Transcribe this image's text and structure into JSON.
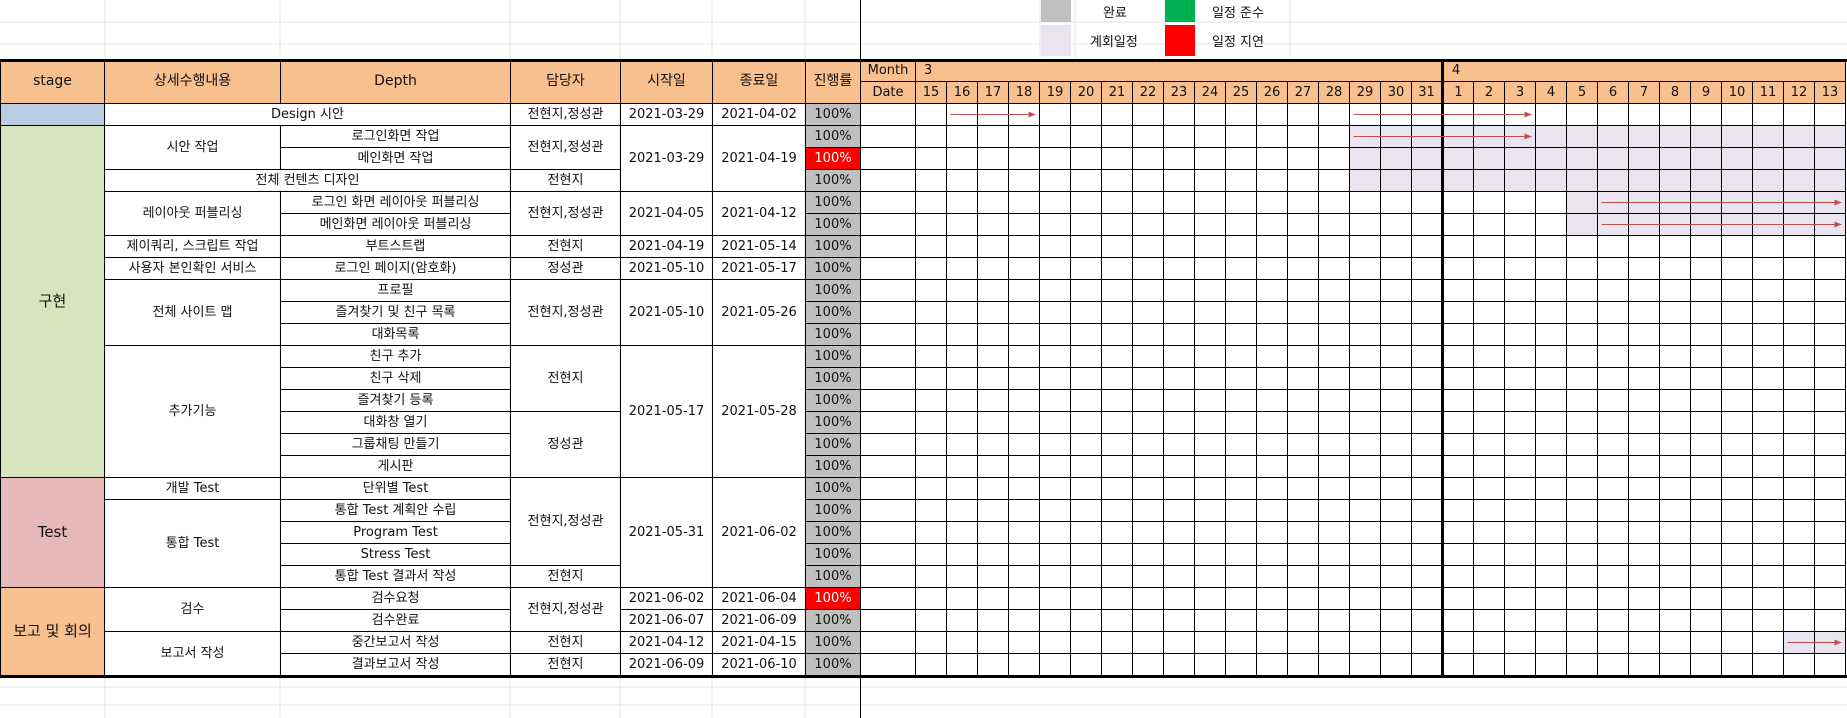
{
  "legend": [
    {
      "label": "완료",
      "color": "#bfbfbf"
    },
    {
      "label": "일정 준수",
      "color": "#00b050"
    },
    {
      "label": "계회일정",
      "color": "#e9e4f0"
    },
    {
      "label": "일정 지연",
      "color": "#ff0000"
    }
  ],
  "headers": {
    "stage": "stage",
    "task": "상세수행내용",
    "depth": "Depth",
    "owner": "담당자",
    "start": "시작일",
    "end": "종료일",
    "progress": "진행률",
    "month": "Month",
    "date": "Date"
  },
  "months": [
    {
      "label": "3",
      "days": [
        "15",
        "16",
        "17",
        "18",
        "19",
        "20",
        "21",
        "22",
        "23",
        "24",
        "25",
        "26",
        "27",
        "28",
        "29",
        "30",
        "31"
      ]
    },
    {
      "label": "4",
      "days": [
        "1",
        "2",
        "3",
        "4",
        "5",
        "6",
        "7",
        "8",
        "9",
        "10",
        "11",
        "12",
        "13"
      ]
    }
  ],
  "stages": [
    {
      "name": "",
      "color": "#b8cce4"
    },
    {
      "name": "구현",
      "color": "#d8e4bc"
    },
    {
      "name": "Test",
      "color": "#e6b8b7"
    },
    {
      "name": "보고 및 회의",
      "color": "#f8c08f"
    }
  ],
  "rows": [
    {
      "task": "Design 시안",
      "depth": "",
      "owner": "전현지,정성관",
      "start": "2021-03-29",
      "end": "2021-04-02",
      "progress": "100%",
      "delayed": false
    },
    {
      "task": "시안 작업",
      "depth": "로그인화면 작업",
      "owner": "전현지,정성관",
      "start": "2021-03-29",
      "end": "2021-04-19",
      "progress": "100%",
      "delayed": false
    },
    {
      "task": "",
      "depth": "메인화면 작업",
      "owner": "",
      "start": "",
      "end": "",
      "progress": "100%",
      "delayed": true
    },
    {
      "task": "전체 컨텐츠 디자인",
      "depth": "",
      "owner": "전현지",
      "start": "",
      "end": "",
      "progress": "100%",
      "delayed": false
    },
    {
      "task": "레이아웃 퍼블리싱",
      "depth": "로그인 화면 레이아웃 퍼블리싱",
      "owner": "전현지,정성관",
      "start": "2021-04-05",
      "end": "2021-04-12",
      "progress": "100%",
      "delayed": false
    },
    {
      "task": "",
      "depth": "메인화면 레이아웃 퍼블리싱",
      "owner": "",
      "start": "",
      "end": "",
      "progress": "100%",
      "delayed": false
    },
    {
      "task": "제이쿼리, 스크립트 작업",
      "depth": "부트스트랩",
      "owner": "전현지",
      "start": "2021-04-19",
      "end": "2021-05-14",
      "progress": "100%",
      "delayed": false
    },
    {
      "task": "사용자 본인확인 서비스",
      "depth": "로그인 페이지(암호화)",
      "owner": "정성관",
      "start": "2021-05-10",
      "end": "2021-05-17",
      "progress": "100%",
      "delayed": false
    },
    {
      "task": "전체 사이트 맵",
      "depth": "프로필",
      "owner": "전현지,정성관",
      "start": "2021-05-10",
      "end": "2021-05-26",
      "progress": "100%",
      "delayed": false
    },
    {
      "task": "",
      "depth": "즐겨찾기 및 친구 목록",
      "owner": "",
      "start": "",
      "end": "",
      "progress": "100%",
      "delayed": false
    },
    {
      "task": "",
      "depth": "대화목록",
      "owner": "",
      "start": "",
      "end": "",
      "progress": "100%",
      "delayed": false
    },
    {
      "task": "추가기능",
      "depth": "친구 추가",
      "owner": "전현지",
      "start": "2021-05-17",
      "end": "2021-05-28",
      "progress": "100%",
      "delayed": false
    },
    {
      "task": "",
      "depth": "친구 삭제",
      "owner": "",
      "start": "",
      "end": "",
      "progress": "100%",
      "delayed": false
    },
    {
      "task": "",
      "depth": "즐겨찾기 등록",
      "owner": "",
      "start": "",
      "end": "",
      "progress": "100%",
      "delayed": false
    },
    {
      "task": "",
      "depth": "대화창 열기",
      "owner": "정성관",
      "start": "",
      "end": "",
      "progress": "100%",
      "delayed": false
    },
    {
      "task": "",
      "depth": "그룹채팅 만들기",
      "owner": "",
      "start": "",
      "end": "",
      "progress": "100%",
      "delayed": false
    },
    {
      "task": "",
      "depth": "게시판",
      "owner": "",
      "start": "",
      "end": "",
      "progress": "100%",
      "delayed": false
    },
    {
      "task": "개발 Test",
      "depth": "단위별 Test",
      "owner": "전현지,정성관",
      "start": "2021-05-31",
      "end": "2021-06-02",
      "progress": "100%",
      "delayed": false
    },
    {
      "task": "통합 Test",
      "depth": "통합 Test 계획안 수립",
      "owner": "",
      "start": "",
      "end": "",
      "progress": "100%",
      "delayed": false
    },
    {
      "task": "",
      "depth": "Program Test",
      "owner": "",
      "start": "",
      "end": "",
      "progress": "100%",
      "delayed": false
    },
    {
      "task": "",
      "depth": "Stress Test",
      "owner": "",
      "start": "",
      "end": "",
      "progress": "100%",
      "delayed": false
    },
    {
      "task": "",
      "depth": "통합 Test 결과서 작성",
      "owner": "전현지",
      "start": "",
      "end": "",
      "progress": "100%",
      "delayed": false
    },
    {
      "task": "검수",
      "depth": "검수요청",
      "owner": "전현지,정성관",
      "start": "2021-06-02",
      "end": "2021-06-04",
      "progress": "100%",
      "delayed": true
    },
    {
      "task": "",
      "depth": "검수완료",
      "owner": "",
      "start": "2021-06-07",
      "end": "2021-06-09",
      "progress": "100%",
      "delayed": false
    },
    {
      "task": "보고서 작성",
      "depth": "중간보고서 작성",
      "owner": "전현지",
      "start": "2021-04-12",
      "end": "2021-04-15",
      "progress": "100%",
      "delayed": false
    },
    {
      "task": "",
      "depth": "결과보고서 작성",
      "owner": "전현지",
      "start": "2021-06-09",
      "end": "2021-06-10",
      "progress": "100%",
      "delayed": false
    }
  ]
}
